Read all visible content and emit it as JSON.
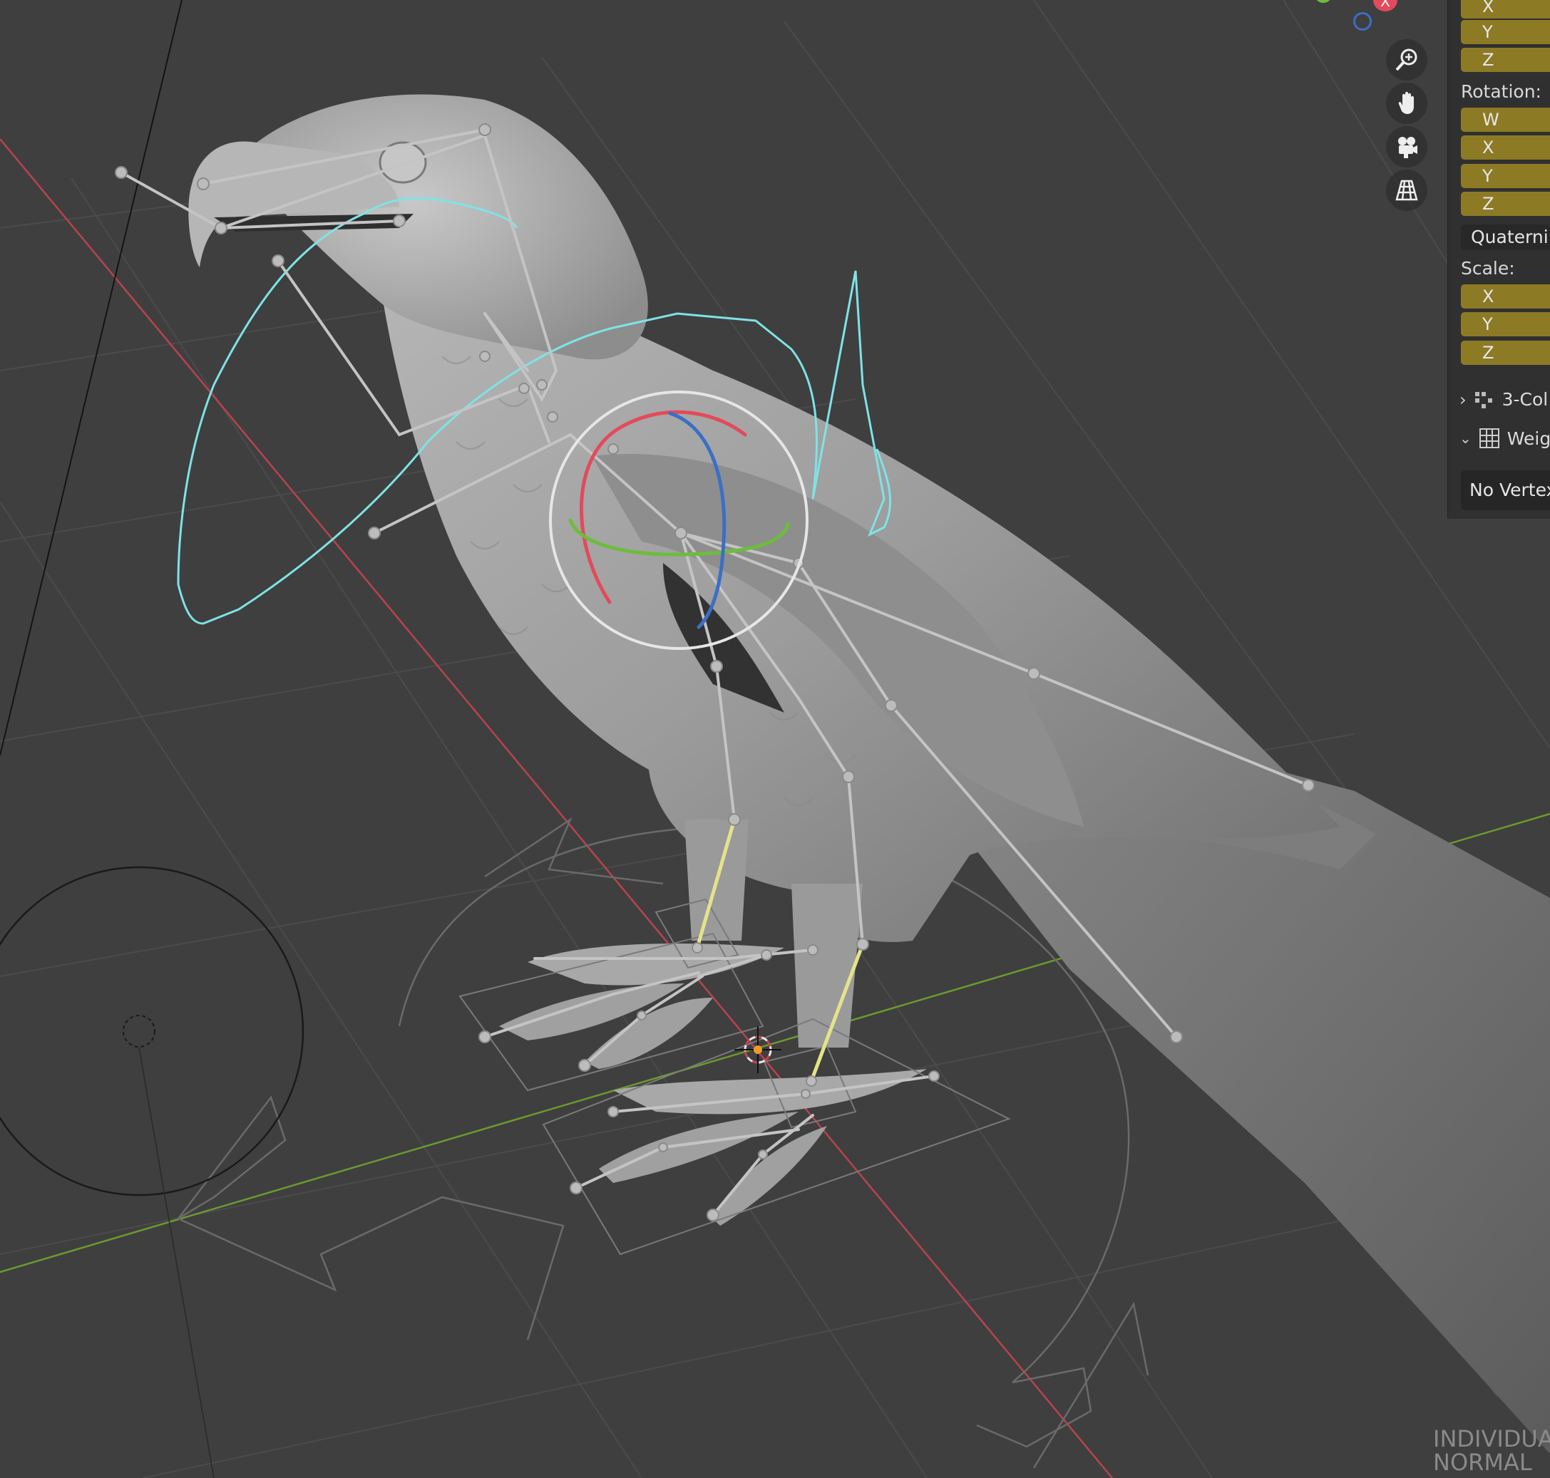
{
  "viewport": {
    "nav_icons": [
      "zoom-icon",
      "hand-pan-icon",
      "camera-icon",
      "perspective-grid-icon"
    ],
    "gizmo_axes": {
      "x_label": "X",
      "x_color": "#e34a5b",
      "y_color": "#6dbd3b",
      "z_color": "#3a6fc6"
    },
    "mode_lines": [
      "INDIVIDUA",
      "NORMAL"
    ]
  },
  "npanel": {
    "location_axes": [
      "X",
      "Y",
      "Z"
    ],
    "rotation_label": "Rotation:",
    "rotation_axes": [
      "W",
      "X",
      "Y",
      "Z"
    ],
    "rotation_mode": "Quaterni",
    "scale_label": "Scale:",
    "scale_axes": [
      "X",
      "Y",
      "Z"
    ],
    "subpanels": [
      {
        "label": "3-Col",
        "icon": "properties-icon",
        "expanded": false
      },
      {
        "label": "Weig",
        "icon": "grid-icon",
        "expanded": true
      }
    ],
    "weights_message": "No Vertex"
  },
  "colors": {
    "field_bg": "#8c7a25",
    "selection_curve": "#7ee3e6",
    "bone": "#bfbfbf",
    "bone_selected": "#e4e38a"
  }
}
